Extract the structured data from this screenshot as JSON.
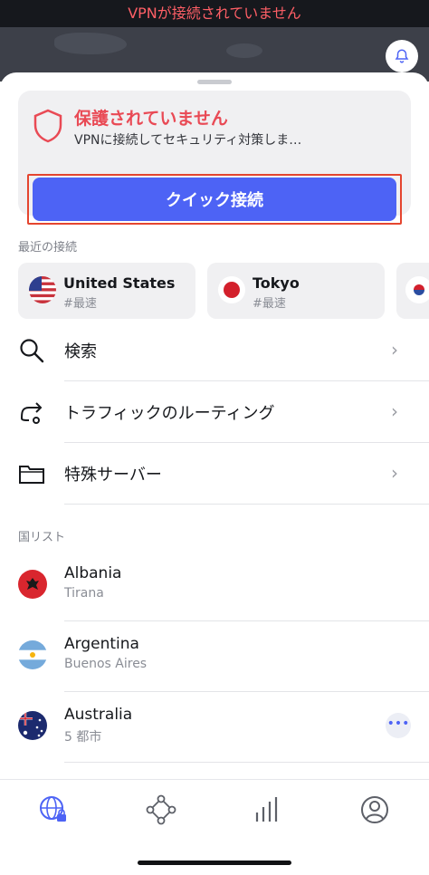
{
  "status": {
    "text": "VPNが接続されていません"
  },
  "protection": {
    "title": "保護されていません",
    "subtitle": "VPNに接続してセキュリティ対策しま…",
    "connect_label": "クイック接続"
  },
  "recent": {
    "label": "最近の接続",
    "items": [
      {
        "name": "United States",
        "tag": "#最速",
        "flag": "us-flag"
      },
      {
        "name": "Tokyo",
        "tag": "#最速",
        "flag": "japan-flag"
      }
    ]
  },
  "menu": [
    {
      "label": "検索",
      "icon": "search-icon"
    },
    {
      "label": "トラフィックのルーティング",
      "icon": "routing-icon"
    },
    {
      "label": "特殊サーバー",
      "icon": "folder-icon"
    }
  ],
  "country_list": {
    "label": "国リスト",
    "items": [
      {
        "name": "Albania",
        "sub": "Tirana",
        "flag": "albania-flag"
      },
      {
        "name": "Argentina",
        "sub": "Buenos Aires",
        "flag": "argentina-flag"
      },
      {
        "name": "Australia",
        "sub": "5 都市",
        "flag": "australia-flag",
        "more": "•••"
      }
    ]
  },
  "nav": [
    {
      "icon": "globe-lock-icon",
      "active": true
    },
    {
      "icon": "meshnet-icon"
    },
    {
      "icon": "stats-icon"
    },
    {
      "icon": "profile-icon"
    }
  ],
  "colors": {
    "accent": "#4d63f5",
    "danger": "#e94a55",
    "highlight": "#e5452f"
  }
}
